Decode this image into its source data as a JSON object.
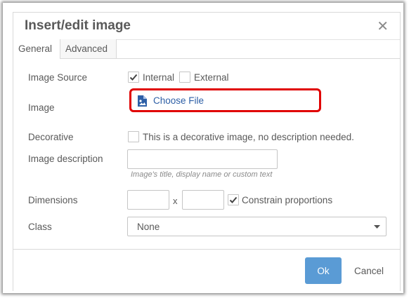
{
  "dialog": {
    "title": "Insert/edit image",
    "close_icon": "close-icon"
  },
  "tabs": [
    {
      "label": "General",
      "active": true
    },
    {
      "label": "Advanced",
      "active": false
    }
  ],
  "form": {
    "image_source": {
      "label": "Image Source",
      "options": [
        {
          "label": "Internal",
          "checked": true
        },
        {
          "label": "External",
          "checked": false
        }
      ]
    },
    "image": {
      "label": "Image",
      "button_label": "Choose File",
      "icon": "image-file-icon",
      "highlight_color": "#e00000"
    },
    "decorative": {
      "label": "Decorative",
      "checkbox_label": "This is a decorative image, no description needed.",
      "checked": false
    },
    "description": {
      "label": "Image description",
      "value": "",
      "hint": "Image's title, display name or custom text"
    },
    "dimensions": {
      "label": "Dimensions",
      "width_value": "",
      "separator": "x",
      "height_value": "",
      "constrain_label": "Constrain proportions",
      "constrain_checked": true
    },
    "class": {
      "label": "Class",
      "selected": "None"
    }
  },
  "footer": {
    "ok_label": "Ok",
    "cancel_label": "Cancel",
    "ok_color": "#5a9bd5"
  }
}
